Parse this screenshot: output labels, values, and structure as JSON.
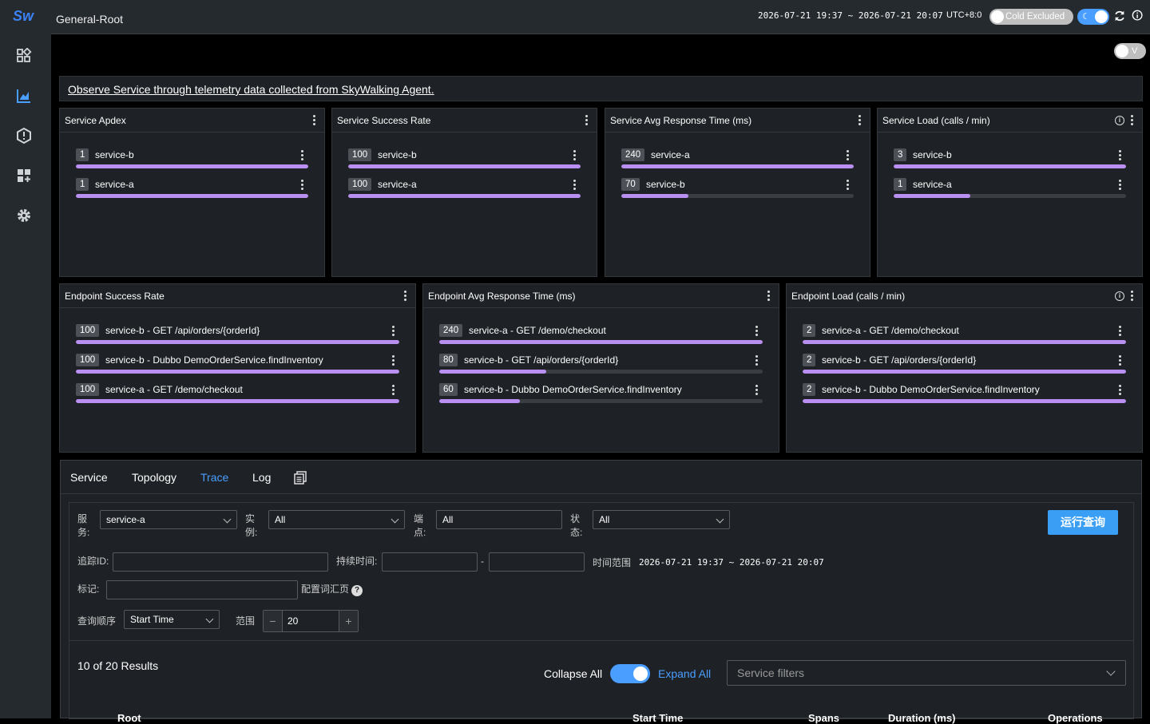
{
  "app": {
    "logo_text": "Sw",
    "page_title": "General-Root"
  },
  "topbar": {
    "time_range": "2026-07-21 19:37 ~ 2026-07-21 20:07",
    "timezone": "UTC+8:0",
    "cold_label": "Cold Excluded",
    "v_label": "V"
  },
  "banner": {
    "text": "Observe Service through telemetry data collected from SkyWalking Agent."
  },
  "panels": [
    {
      "title": "Service Apdex",
      "rows": [
        {
          "badge": "1",
          "label": "service-b",
          "fill": 1.0
        },
        {
          "badge": "1",
          "label": "service-a",
          "fill": 1.0
        }
      ]
    },
    {
      "title": "Service Success Rate",
      "rows": [
        {
          "badge": "100",
          "label": "service-b",
          "fill": 1.0
        },
        {
          "badge": "100",
          "label": "service-a",
          "fill": 1.0
        }
      ]
    },
    {
      "title": "Service Avg Response Time (ms)",
      "rows": [
        {
          "badge": "240",
          "label": "service-a",
          "fill": 1.0
        },
        {
          "badge": "70",
          "label": "service-b",
          "fill": 0.29
        }
      ]
    },
    {
      "title": "Service Load (calls / min)",
      "rows": [
        {
          "badge": "3",
          "label": "service-b",
          "fill": 1.0
        },
        {
          "badge": "1",
          "label": "service-a",
          "fill": 0.33
        }
      ]
    },
    {
      "title": "Endpoint Success Rate",
      "rows": [
        {
          "badge": "100",
          "label": "service-b - GET /api/orders/{orderId}",
          "fill": 1.0
        },
        {
          "badge": "100",
          "label": "service-b - Dubbo DemoOrderService.findInventory",
          "fill": 1.0
        },
        {
          "badge": "100",
          "label": "service-a - GET /demo/checkout",
          "fill": 1.0
        }
      ]
    },
    {
      "title": "Endpoint Avg Response Time (ms)",
      "rows": [
        {
          "badge": "240",
          "label": "service-a - GET /demo/checkout",
          "fill": 1.0
        },
        {
          "badge": "80",
          "label": "service-b - GET /api/orders/{orderId}",
          "fill": 0.33
        },
        {
          "badge": "60",
          "label": "service-b - Dubbo DemoOrderService.findInventory",
          "fill": 0.25
        }
      ]
    },
    {
      "title": "Endpoint Load (calls / min)",
      "rows": [
        {
          "badge": "2",
          "label": "service-a - GET /demo/checkout",
          "fill": 1.0
        },
        {
          "badge": "2",
          "label": "service-b - GET /api/orders/{orderId}",
          "fill": 1.0
        },
        {
          "badge": "2",
          "label": "service-b - Dubbo DemoOrderService.findInventory",
          "fill": 1.0
        }
      ]
    }
  ],
  "tabs": {
    "service": "Service",
    "topology": "Topology",
    "trace": "Trace",
    "log": "Log"
  },
  "trace_form": {
    "service_label_1": "服",
    "service_label_2": "务:",
    "service_value": "service-a",
    "instance_label_1": "实",
    "instance_label_2": "例:",
    "instance_value": "All",
    "endpoint_label_1": "端",
    "endpoint_label_2": "点:",
    "endpoint_value": "All",
    "status_label_1": "状",
    "status_label_2": "态:",
    "status_value": "All",
    "run_label": "运行查询",
    "trace_id_label": "追踪ID:",
    "duration_label": "持续时间:",
    "duration_sep": "-",
    "time_range_label": "时间范围",
    "time_range_value": "2026-07-21 19:37 ~ 2026-07-21 20:07",
    "tags_label": "标记:",
    "config_label": "配置词汇页",
    "order_label": "查询顺序",
    "order_value": "Start Time",
    "range_label": "范围",
    "range_value": "20"
  },
  "results": {
    "count_text": "10 of 20 Results",
    "collapse_label": "Collapse All",
    "expand_label": "Expand All",
    "filter_placeholder": "Service filters"
  },
  "table_headers": {
    "root": "Root",
    "start_time": "Start Time",
    "spans": "Spans",
    "duration": "Duration (ms)",
    "operations": "Operations"
  }
}
